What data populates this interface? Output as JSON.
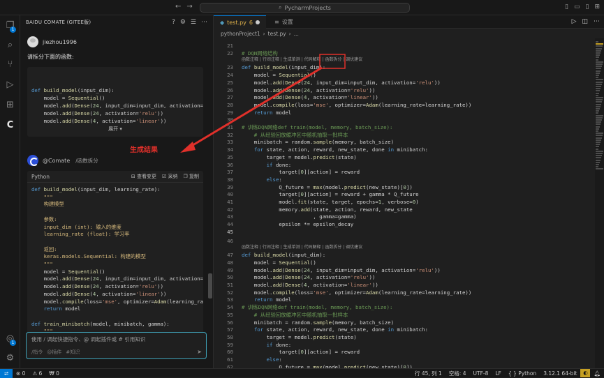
{
  "titlebar": {
    "search": "PycharmProjects",
    "back": "←",
    "forward": "→"
  },
  "activity": {
    "explorer_badge": "1",
    "account_badge": "1"
  },
  "panel": {
    "title": "BAIDU COMATE (GITEE版)",
    "user": "jiezhou1996",
    "prompt": "请拆分下面的函数:",
    "input_code": [
      "def build_model(input_dim):",
      "    model = Sequential()",
      "    model.add(Dense(24, input_dim=input_dim, activation='",
      "    model.add(Dense(24, activation='relu'))",
      "    model.add(Dense(4, activation='linear'))"
    ],
    "expand": "展开 ▾",
    "assistant": "@Comate",
    "command": "/函数拆分",
    "generated_label": "生成结果",
    "result_lang": "Python",
    "actions": [
      "查看变更",
      "采纳",
      "复制"
    ],
    "result_code": [
      "def build_model(input_dim, learning_rate):",
      "    \"\"\"",
      "    构建模型",
      "",
      "    参数:",
      "    input_dim (int): 输入的维度",
      "    learning_rate (float): 学习率",
      "",
      "    返回:",
      "    keras.models.Sequential: 构建的模型",
      "    \"\"\"",
      "    model = Sequential()",
      "    model.add(Dense(24, input_dim=input_dim, activation=",
      "    model.add(Dense(24, activation='relu'))",
      "    model.add(Dense(4, activation='linear'))",
      "    model.compile(loss='mse', optimizer=Adam(learning_rat",
      "    return model",
      "",
      "def train_minibatch(model, minibatch, gamma):",
      "    \"\"\""
    ],
    "chat_placeholder": "使用 / 调起快捷指令、@ 调起插件或 # 引用知识",
    "chat_hints": [
      "/指令",
      "@插件",
      "#知识"
    ]
  },
  "tabs": [
    {
      "name": "test.py",
      "count": "6"
    },
    {
      "name": "设置"
    }
  ],
  "breadcrumb": [
    "pythonProject1",
    "test.py",
    "..."
  ],
  "code_lens": "函数注释 | 行间注释 | 生成单测 | 代码解释 | 函数拆分 | 调优建议",
  "code_lines": [
    {
      "n": "21",
      "t": ""
    },
    {
      "n": "22",
      "t": "# DQN网络结构"
    },
    {
      "n": "23",
      "t": "def build_model(input_dim):"
    },
    {
      "n": "24",
      "t": "    model = Sequential()"
    },
    {
      "n": "25",
      "t": "    model.add(Dense(24, input_dim=input_dim, activation='relu'))"
    },
    {
      "n": "26",
      "t": "    model.add(Dense(24, activation='relu'))"
    },
    {
      "n": "27",
      "t": "    model.add(Dense(4, activation='linear'))"
    },
    {
      "n": "28",
      "t": "    model.compile(loss='mse', optimizer=Adam(learning_rate=learning_rate))"
    },
    {
      "n": "29",
      "t": "    return model"
    },
    {
      "n": "30",
      "t": ""
    },
    {
      "n": "31",
      "t": "# 训练DQN网络def train(model, memory, batch_size):"
    },
    {
      "n": "32",
      "t": "    # 从经验回放缓冲区中随机抽取一批样本"
    },
    {
      "n": "33",
      "t": "    minibatch = random.sample(memory, batch_size)"
    },
    {
      "n": "34",
      "t": "    for state, action, reward, new_state, done in minibatch:"
    },
    {
      "n": "35",
      "t": "        target = model.predict(state)"
    },
    {
      "n": "36",
      "t": "        if done:"
    },
    {
      "n": "37",
      "t": "            target[0][action] = reward"
    },
    {
      "n": "38",
      "t": "        else:"
    },
    {
      "n": "39",
      "t": "            Q_future = max(model.predict(new_state)[0])"
    },
    {
      "n": "40",
      "t": "            target[0][action] = reward + gamma * Q_future"
    },
    {
      "n": "41",
      "t": "            model.fit(state, target, epochs=1, verbose=0)"
    },
    {
      "n": "42",
      "t": "            memory.add(state, action, reward, new_state"
    },
    {
      "n": "43",
      "t": "                       , gamma=gamma)"
    },
    {
      "n": "44",
      "t": "            epsilon *= epsilon_decay"
    },
    {
      "n": "45",
      "t": ""
    },
    {
      "n": "46",
      "t": ""
    },
    {
      "n": "47",
      "t": "def build_model(input_dim):"
    },
    {
      "n": "48",
      "t": "    model = Sequential()"
    },
    {
      "n": "49",
      "t": "    model.add(Dense(24, input_dim=input_dim, activation='relu'))"
    },
    {
      "n": "50",
      "t": "    model.add(Dense(24, activation='relu'))"
    },
    {
      "n": "51",
      "t": "    model.add(Dense(4, activation='linear'))"
    },
    {
      "n": "52",
      "t": "    model.compile(loss='mse', optimizer=Adam(learning_rate=learning_rate))"
    },
    {
      "n": "53",
      "t": "    return model"
    },
    {
      "n": "54",
      "t": "# 训练DQN网络def train(model, memory, batch_size):"
    },
    {
      "n": "55",
      "t": "    # 从经验回放缓冲区中随机抽取一批样本"
    },
    {
      "n": "56",
      "t": "    minibatch = random.sample(memory, batch_size)"
    },
    {
      "n": "57",
      "t": "    for state, action, reward, new_state, done in minibatch:"
    },
    {
      "n": "58",
      "t": "        target = model.predict(state)"
    },
    {
      "n": "59",
      "t": "        if done:"
    },
    {
      "n": "60",
      "t": "            target[0][action] = reward"
    },
    {
      "n": "61",
      "t": "        else:"
    },
    {
      "n": "62",
      "t": "            Q_future = max(model.predict(new_state)[0])"
    }
  ],
  "status": {
    "errors": "⊗ 0",
    "warnings": "⚠ 6",
    "ports": "₩ 0",
    "position": "行 45, 列 1",
    "spaces": "空格: 4",
    "encoding": "UTF-8",
    "eol": "LF",
    "language": "Python",
    "interpreter": "3.12.1 64-bit"
  },
  "colors": {
    "accent": "#0078d4",
    "highlight": "#e0302a",
    "input_border": "#3fa2b8"
  }
}
